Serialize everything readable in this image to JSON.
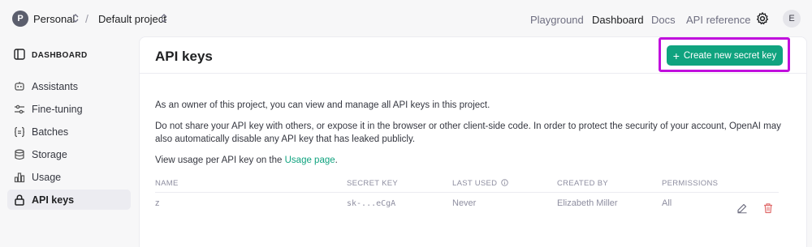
{
  "topbar": {
    "org_initial": "P",
    "org_name": "Personal",
    "separator": "/",
    "project_name": "Default project",
    "nav": [
      {
        "label": "Playground"
      },
      {
        "label": "Dashboard"
      },
      {
        "label": "Docs"
      },
      {
        "label": "API reference"
      }
    ],
    "active_nav": "Dashboard",
    "settings_icon": "gear-icon",
    "user_initial": "E"
  },
  "sidebar": {
    "header": "DASHBOARD",
    "header_icon": "sidebar-panel-icon",
    "items": [
      {
        "label": "Assistants",
        "icon": "robot-icon"
      },
      {
        "label": "Fine-tuning",
        "icon": "sliders-icon"
      },
      {
        "label": "Batches",
        "icon": "braces-icon"
      },
      {
        "label": "Storage",
        "icon": "database-icon"
      },
      {
        "label": "Usage",
        "icon": "bar-chart-icon"
      },
      {
        "label": "API keys",
        "icon": "lock-icon"
      }
    ],
    "active_item": "API keys"
  },
  "main": {
    "title": "API keys",
    "create_button_label": "Create new secret key",
    "create_button_icon": "plus-icon",
    "intro": "As an owner of this project, you can view and manage all API keys in this project.",
    "warning": "Do not share your API key with others, or expose it in the browser or other client-side code. In order to protect the security of your account, OpenAI may also automatically disable any API key that has leaked publicly.",
    "usage_prefix": "View usage per API key on the ",
    "usage_link": "Usage page",
    "usage_suffix": ".",
    "table": {
      "columns": [
        "NAME",
        "SECRET KEY",
        "LAST USED",
        "CREATED BY",
        "PERMISSIONS"
      ],
      "last_used_info_icon": "info-icon",
      "rows": [
        {
          "name": "z",
          "secret_key": "sk-...eCgA",
          "last_used": "Never",
          "created_by": "Elizabeth Miller",
          "permissions": "All",
          "edit_icon": "pencil-icon",
          "delete_icon": "trash-icon"
        }
      ]
    }
  },
  "colors": {
    "accent": "#10a37f",
    "highlight": "#c10fdd",
    "delete": "#e06c6c",
    "active_bg": "#ececf1"
  }
}
